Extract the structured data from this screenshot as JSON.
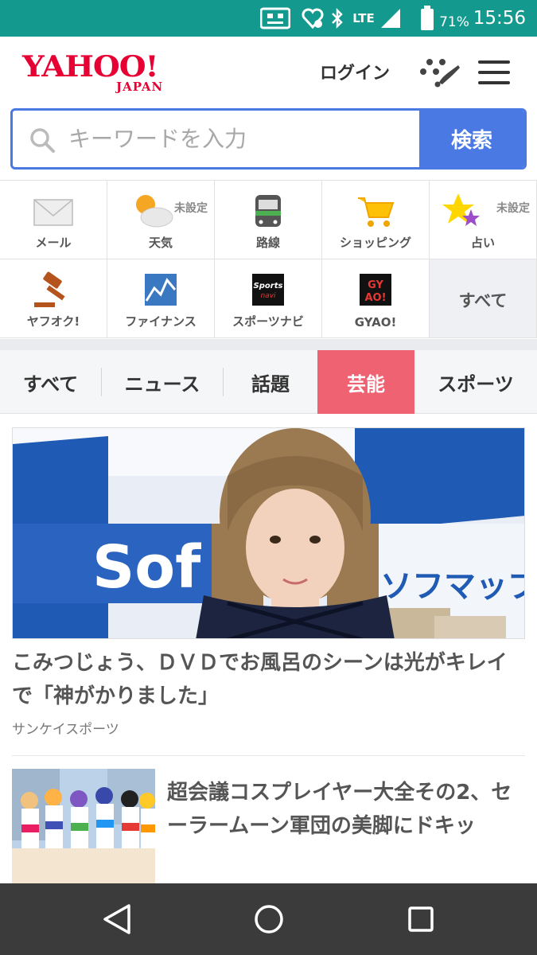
{
  "status_bar": {
    "time": "15:56",
    "battery_percent": "71%",
    "network": "LTE",
    "icons": [
      "notification-icon",
      "heart-rate-icon",
      "bluetooth-icon",
      "signal-icon",
      "battery-icon"
    ],
    "background_color": "#13998e"
  },
  "header": {
    "logo_main": "YAHOO!",
    "logo_sub": "JAPAN",
    "login_label": "ログイン",
    "brand_color": "#e60033"
  },
  "search": {
    "placeholder": "キーワードを入力",
    "button_label": "検索",
    "accent_color": "#4a79e3"
  },
  "services": {
    "items": [
      {
        "label": "メール",
        "icon": "mail-icon"
      },
      {
        "label": "天気",
        "sub": "未設定",
        "icon": "weather-icon"
      },
      {
        "label": "路線",
        "icon": "train-icon"
      },
      {
        "label": "ショッピング",
        "icon": "cart-icon"
      },
      {
        "label": "占い",
        "sub": "未設定",
        "icon": "star-icon"
      },
      {
        "label": "ヤフオク!",
        "icon": "auction-icon"
      },
      {
        "label": "ファイナンス",
        "icon": "finance-icon"
      },
      {
        "label": "スポーツナビ",
        "icon": "sportsnavi-icon"
      },
      {
        "label": "GYAO!",
        "icon": "gyao-icon"
      },
      {
        "label": "すべて"
      }
    ]
  },
  "tabs": {
    "items": [
      {
        "label": "すべて"
      },
      {
        "label": "ニュース"
      },
      {
        "label": "話題"
      },
      {
        "label": "芸能",
        "active": true
      },
      {
        "label": "スポーツ"
      }
    ],
    "active_color": "#ef6272"
  },
  "articles": [
    {
      "headline": "こみつじょう、ＤＶＤでお風呂のシーンは光がキレイで「神がかりました」",
      "source": "サンケイスポーツ",
      "image_text": [
        "Sof",
        "ソフマップ"
      ]
    },
    {
      "headline": "超会議コスプレイヤー大全その2、セーラームーン軍団の美脚にドキッ"
    }
  ],
  "nav_bar": {
    "buttons": [
      "back-icon",
      "home-icon",
      "recents-icon"
    ]
  }
}
